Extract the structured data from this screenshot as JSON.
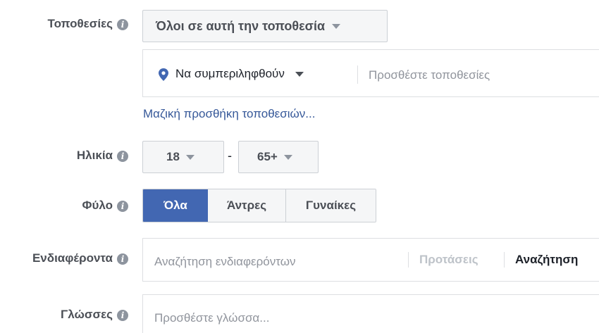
{
  "locations": {
    "label": "Τοποθεσίες",
    "audience_dropdown": "Όλοι σε αυτή την τοποθεσία",
    "include_dropdown": "Να συμπεριληφθούν",
    "placeholder": "Προσθέστε τοποθεσίες",
    "bulk_link": "Μαζική προσθήκη τοποθεσιών..."
  },
  "age": {
    "label": "Ηλικία",
    "min": "18",
    "separator": "-",
    "max": "65+"
  },
  "gender": {
    "label": "Φύλο",
    "options": [
      "Όλα",
      "Άντρες",
      "Γυναίκες"
    ],
    "selected": "Όλα"
  },
  "interests": {
    "label": "Ενδιαφέροντα",
    "placeholder": "Αναζήτηση ενδιαφερόντων",
    "suggestions": "Προτάσεις",
    "browse": "Αναζήτηση"
  },
  "languages": {
    "label": "Γλώσσες",
    "placeholder": "Προσθέστε γλώσσα..."
  },
  "colors": {
    "accent": "#4267b2",
    "link": "#365899",
    "pin": "#4267b2"
  }
}
